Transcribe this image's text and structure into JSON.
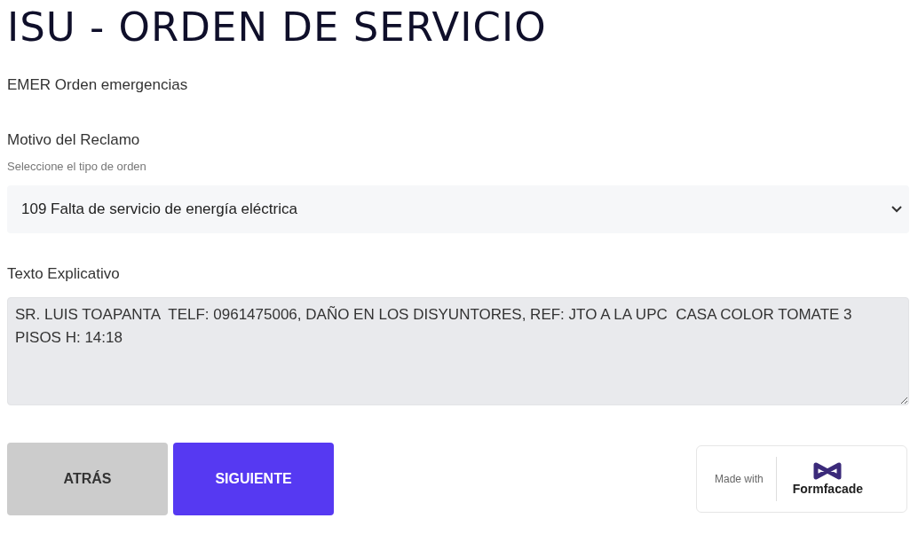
{
  "title": "ISU - ORDEN DE SERVICIO",
  "order_type": "EMER Orden emergencias",
  "reason": {
    "label": "Motivo del Reclamo",
    "hint": "Seleccione el tipo de orden",
    "value": "109 Falta de servicio de energía eléctrica"
  },
  "explanation": {
    "label": "Texto Explicativo",
    "value": "SR. LUIS TOAPANTA  TELF: 0961475006, DAÑO EN LOS DISYUNTORES, REF: JTO A LA UPC  CASA COLOR TOMATE 3 PISOS H: 14:18"
  },
  "buttons": [
    {
      "label": "ATRÁS",
      "kind": "secondary"
    },
    {
      "label": "SIGUIENTE",
      "kind": "primary"
    }
  ],
  "badge": {
    "prefix": "Made with",
    "brand": "Formfacade"
  }
}
